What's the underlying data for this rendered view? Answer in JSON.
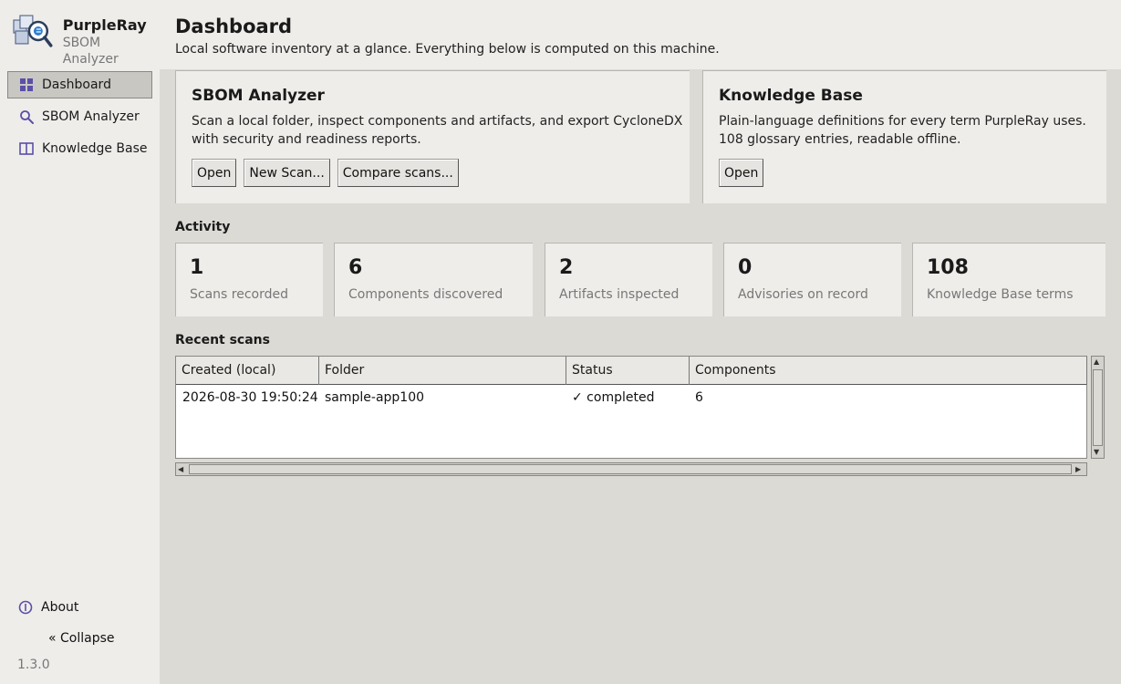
{
  "brand": {
    "name": "PurpleRay",
    "subtitle": "SBOM Analyzer"
  },
  "sidebar": {
    "items": [
      {
        "label": "Dashboard",
        "icon": "grid-icon",
        "active": true
      },
      {
        "label": "SBOM Analyzer",
        "icon": "search-icon",
        "active": false
      },
      {
        "label": "Knowledge Base",
        "icon": "book-icon",
        "active": false
      }
    ],
    "about_label": "About",
    "collapse_label": "« Collapse",
    "version": "1.3.0"
  },
  "header": {
    "title": "Dashboard",
    "subtitle": "Local software inventory at a glance. Everything below is computed on this machine."
  },
  "cards": {
    "sbom": {
      "title": "SBOM Analyzer",
      "desc_line1": "Scan a local folder, inspect components and artifacts, and export CycloneDX",
      "desc_line2": "with security and readiness reports.",
      "open_label": "Open",
      "new_scan_label": "New Scan...",
      "compare_label": "Compare scans..."
    },
    "kb": {
      "title": "Knowledge Base",
      "desc_line1": "Plain-language definitions for every term PurpleRay uses.",
      "desc_line2": "108 glossary entries, readable offline.",
      "open_label": "Open"
    }
  },
  "activity": {
    "label": "Activity",
    "stats": [
      {
        "value": "1",
        "label": "Scans recorded"
      },
      {
        "value": "6",
        "label": "Components discovered"
      },
      {
        "value": "2",
        "label": "Artifacts inspected"
      },
      {
        "value": "0",
        "label": "Advisories on record"
      },
      {
        "value": "108",
        "label": "Knowledge Base terms"
      }
    ]
  },
  "recent_scans": {
    "label": "Recent scans",
    "columns": [
      "Created (local)",
      "Folder",
      "Status",
      "Components"
    ],
    "rows": [
      {
        "created": "2026-08-30 19:50:24",
        "folder": "sample-app100",
        "status": "✓ completed",
        "components": "6"
      }
    ]
  },
  "colors": {
    "accent": "#5b4fa8",
    "active_nav_bg": "#c9c7c2"
  }
}
